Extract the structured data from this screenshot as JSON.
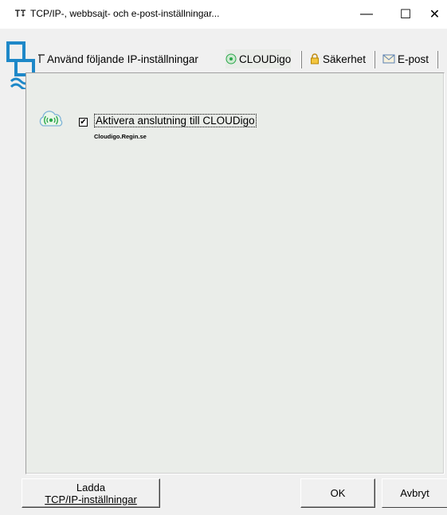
{
  "window": {
    "title": "TCP/IP-, webbsajt- och e-post-inställningar...",
    "minimize_glyph": "—",
    "maximize_glyph": "☐",
    "close_glyph": "✕"
  },
  "tabs": [
    {
      "label": "Använd följande IP-inställningar",
      "icon": "network-icon",
      "active": false
    },
    {
      "label": "CLOUDigo",
      "icon": "cloudigo-icon",
      "active": true
    },
    {
      "label": "Säkerhet",
      "icon": "lock-icon",
      "active": false
    },
    {
      "label": "E-post",
      "icon": "envelope-icon",
      "active": false
    }
  ],
  "cloudigo": {
    "checkbox_label": "Aktivera anslutning till CLOUDigo",
    "checked": true,
    "check_glyph": "✔",
    "host": "Cloudigo.Regin.se"
  },
  "buttons": {
    "load_line1": "Ladda",
    "load_line2": "TCP/IP-inställningar",
    "ok": "OK",
    "cancel": "Avbryt"
  },
  "colors": {
    "accent_blue": "#1e88c8",
    "cloud_green": "#2aa84a",
    "panel_bg": "#eaede9"
  }
}
